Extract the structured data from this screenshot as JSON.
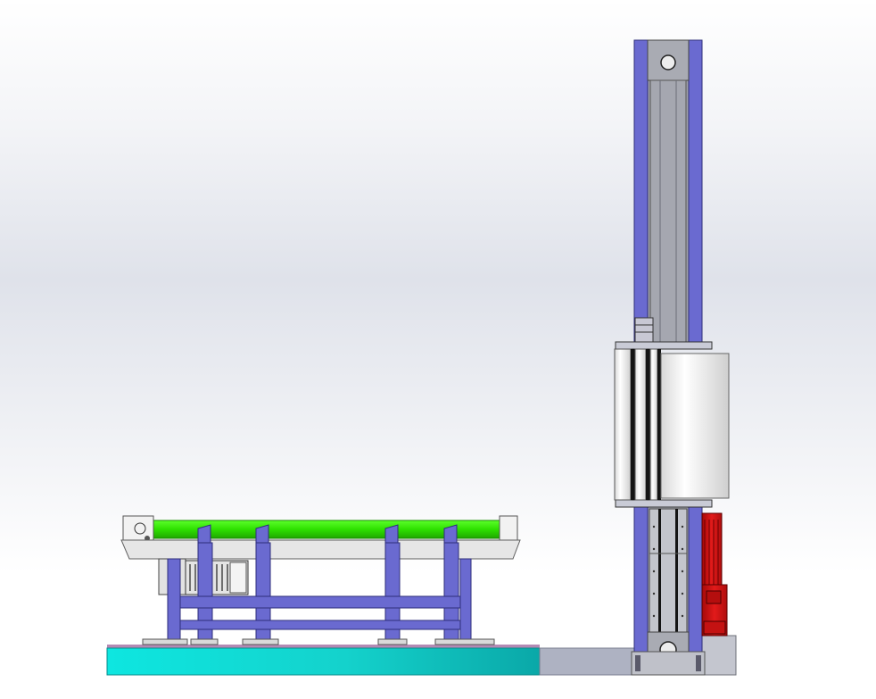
{
  "scene": {
    "view": "side",
    "components": [
      "roller-conveyor",
      "vertical-mast",
      "film-carriage",
      "lift-motor",
      "base-platform"
    ]
  },
  "colors": {
    "structure_blue": "#6a6ad0",
    "roller_green": "#33e600",
    "platform_teal": "#12d8d2",
    "motor_red": "#d41414",
    "steel_gray": "#aeb0b8",
    "film_white": "#f0f0f0",
    "dark_gap": "#141414"
  }
}
